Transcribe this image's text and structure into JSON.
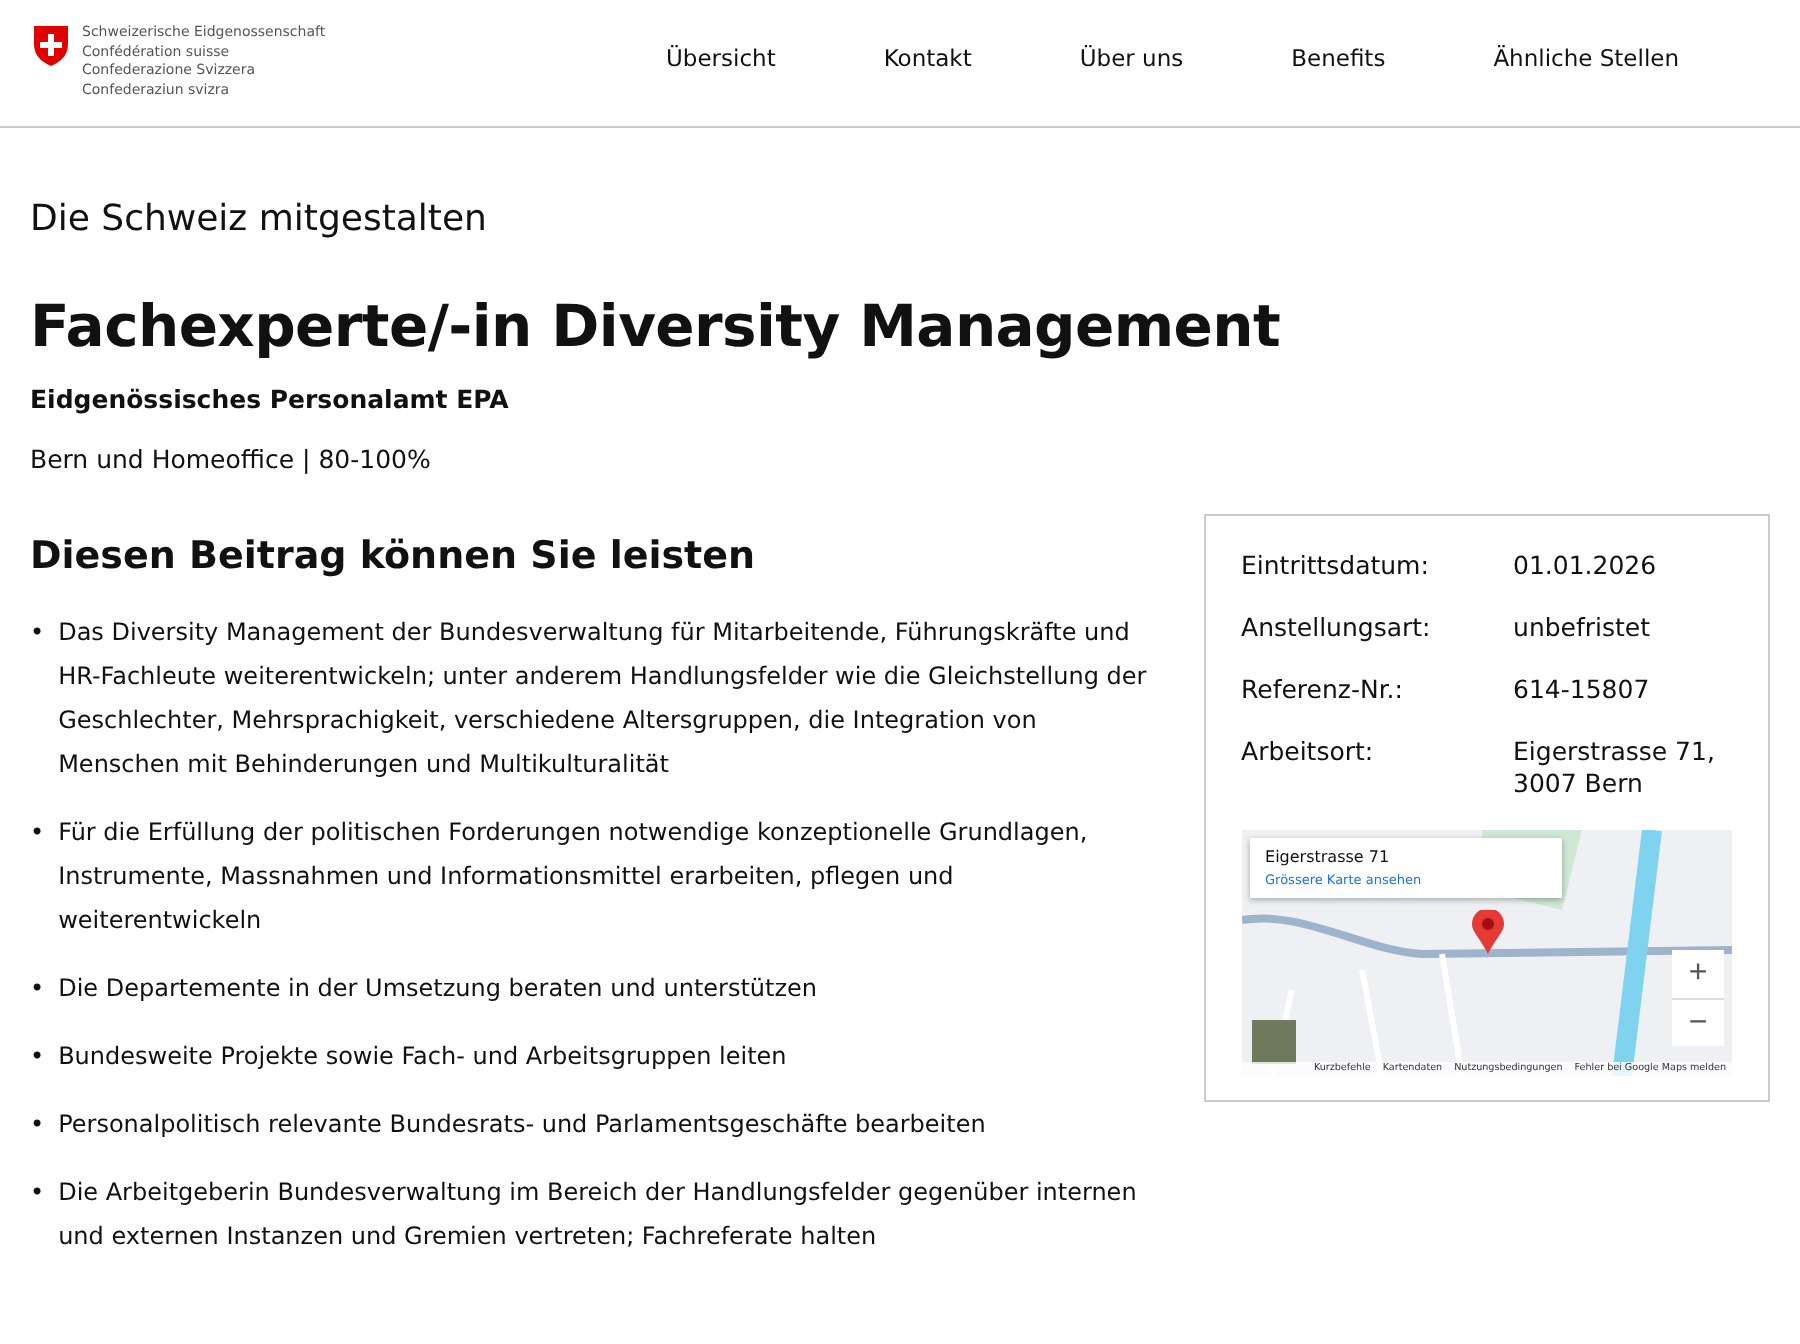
{
  "header": {
    "logo_lines": [
      "Schweizerische Eidgenossenschaft",
      "Confédération suisse",
      "Confederazione Svizzera",
      "Confederaziun svizra"
    ],
    "nav": [
      "Übersicht",
      "Kontakt",
      "Über uns",
      "Benefits",
      "Ähnliche Stellen"
    ]
  },
  "kicker": "Die Schweiz mitgestalten",
  "job": {
    "title": "Fachexperte/-in Diversity Management",
    "employer": "Eidgenössisches Personalamt EPA",
    "location": "Bern und Homeoffice | 80-100%"
  },
  "section": {
    "heading": "Diesen Beitrag können Sie leisten",
    "marker": "•",
    "bullets": [
      "Das Diversity Management der Bundesverwaltung für Mitarbeitende, Führungskräfte und HR-Fachleute weiterentwickeln; unter anderem Handlungsfelder wie die Gleichstellung der Geschlechter, Mehrsprachigkeit, verschiedene Altersgruppen, die Integration von Menschen mit Behinderungen und Multikulturalität",
      "Für die Erfüllung der politischen Forderungen notwendige konzeptionelle Grundlagen, Instrumente, Massnahmen und Informationsmittel erarbeiten, pflegen und weiterentwickeln",
      "Die Departemente in der Umsetzung beraten und unterstützen",
      "Bundesweite Projekte sowie Fach- und Arbeitsgruppen leiten",
      "Personalpolitisch relevante Bundesrats- und Parlamentsgeschäfte bearbeiten",
      "Die Arbeitgeberin Bundesverwaltung im Bereich der Handlungsfelder gegenüber internen und externen Instanzen und Gremien vertreten; Fachreferate halten"
    ]
  },
  "facts": [
    {
      "label": "Eintrittsdatum:",
      "value": "01.01.2026"
    },
    {
      "label": "Anstellungsart:",
      "value": "unbefristet"
    },
    {
      "label": "Referenz-Nr.:",
      "value": "614-15807"
    },
    {
      "label": "Arbeitsort:",
      "value": "Eigerstrasse 71, 3007 Bern"
    }
  ],
  "map": {
    "place": "Eigerstrasse 71",
    "link": "Grössere Karte ansehen",
    "zoom": [
      "+",
      "−"
    ],
    "footer": [
      "Kurzbefehle",
      "Kartendaten",
      "Nutzungsbedingungen",
      "Fehler bei Google Maps melden"
    ]
  }
}
